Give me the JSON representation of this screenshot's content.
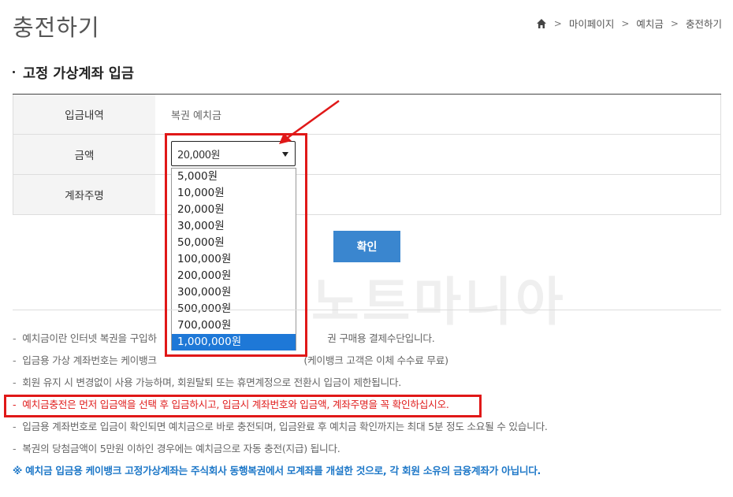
{
  "header": {
    "title": "충전하기",
    "breadcrumb": [
      "마이페이지",
      "예치금",
      "충전하기"
    ]
  },
  "section": {
    "title": "고정 가상계좌 입금"
  },
  "form": {
    "rows": [
      {
        "label": "입금내역",
        "value": "복권 예치금"
      },
      {
        "label": "금액",
        "value": ""
      },
      {
        "label": "계좌주명",
        "value": ""
      }
    ],
    "amount_selected": "20,000원",
    "amount_options": [
      "5,000원",
      "10,000원",
      "20,000원",
      "30,000원",
      "50,000원",
      "100,000원",
      "200,000원",
      "300,000원",
      "500,000원",
      "700,000원",
      "1,000,000원"
    ],
    "highlighted_option_index": 10,
    "confirm_label": "확인"
  },
  "watermark": "노트마니아",
  "notes": [
    {
      "text": "예치금이란 인터넷 복권을 구입하                                                          권 구매용 결제수단입니다.",
      "style": "normal"
    },
    {
      "text": "입금용 가상 계좌번호는 케이뱅크                                                  (케이뱅크 고객은 이체 수수료 무료)",
      "style": "normal"
    },
    {
      "text": "회원 유지 시 변경없이 사용 가능하며, 회원탈퇴 또는 휴면계정으로 전환시 입금이 제한됩니다.",
      "style": "normal"
    },
    {
      "text": "예치금충전은 먼저 입금액을 선택 후 입금하시고, 입금시 계좌번호와 입금액, 계좌주명을 꼭 확인하십시오.",
      "style": "red"
    },
    {
      "text": "입금용 계좌번호로 입금이 확인되면 예치금으로 바로 충전되며, 입금완료 후 예치금 확인까지는 최대 5분 정도 소요될 수 있습니다.",
      "style": "normal"
    },
    {
      "text": "복권의 당첨금액이 5만원 이하인 경우에는 예치금으로 자동 충전(지급) 됩니다.",
      "style": "normal"
    }
  ],
  "notice": "※ 예치금 입금용 케이뱅크 고정가상계좌는 주식회사 동행복권에서 모계좌를 개설한 것으로, 각 회원 소유의 금융계좌가 아닙니다.",
  "colors": {
    "accent": "#3a86cf",
    "highlight": "#e01818",
    "notice": "#1e78c8",
    "selected_option": "#1e78d7"
  }
}
